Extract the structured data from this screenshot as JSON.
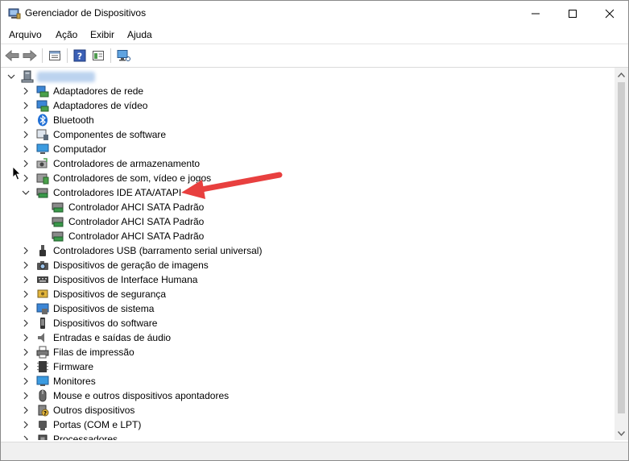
{
  "window": {
    "title": "Gerenciador de Dispositivos",
    "icon": "device-manager-icon"
  },
  "menu": {
    "items": [
      "Arquivo",
      "Ação",
      "Exibir",
      "Ajuda"
    ]
  },
  "toolbar": {
    "buttons": [
      "back-arrow-icon",
      "forward-arrow-icon",
      "properties-icon",
      "help-icon",
      "view-icon",
      "scan-hardware-icon"
    ]
  },
  "tree": {
    "root_label": "",
    "categories": [
      {
        "label": "Adaptadores de rede",
        "icon": "network-adapter-icon",
        "expanded": false
      },
      {
        "label": "Adaptadores de vídeo",
        "icon": "display-adapter-icon",
        "expanded": false
      },
      {
        "label": "Bluetooth",
        "icon": "bluetooth-icon",
        "expanded": false
      },
      {
        "label": "Componentes de software",
        "icon": "software-component-icon",
        "expanded": false
      },
      {
        "label": "Computador",
        "icon": "computer-icon",
        "expanded": false
      },
      {
        "label": "Controladores de armazenamento",
        "icon": "storage-controller-icon",
        "expanded": false
      },
      {
        "label": "Controladores de som, vídeo e jogos",
        "icon": "sound-icon",
        "expanded": false
      },
      {
        "label": "Controladores IDE ATA/ATAPI",
        "icon": "ide-controller-icon",
        "expanded": true,
        "children": [
          "Controlador AHCI SATA Padrão",
          "Controlador AHCI SATA Padrão",
          "Controlador AHCI SATA Padrão"
        ]
      },
      {
        "label": "Controladores USB (barramento serial universal)",
        "icon": "usb-icon",
        "expanded": false
      },
      {
        "label": "Dispositivos de geração de imagens",
        "icon": "camera-icon",
        "expanded": false
      },
      {
        "label": "Dispositivos de Interface Humana",
        "icon": "hid-icon",
        "expanded": false
      },
      {
        "label": "Dispositivos de segurança",
        "icon": "security-device-icon",
        "expanded": false
      },
      {
        "label": "Dispositivos de sistema",
        "icon": "system-device-icon",
        "expanded": false
      },
      {
        "label": "Dispositivos do software",
        "icon": "software-device-icon",
        "expanded": false
      },
      {
        "label": "Entradas e saídas de áudio",
        "icon": "audio-io-icon",
        "expanded": false
      },
      {
        "label": "Filas de impressão",
        "icon": "printer-icon",
        "expanded": false
      },
      {
        "label": "Firmware",
        "icon": "firmware-icon",
        "expanded": false
      },
      {
        "label": "Monitores",
        "icon": "monitor-icon",
        "expanded": false
      },
      {
        "label": "Mouse e outros dispositivos apontadores",
        "icon": "mouse-icon",
        "expanded": false
      },
      {
        "label": "Outros dispositivos",
        "icon": "other-device-icon",
        "expanded": false
      },
      {
        "label": "Portas (COM e LPT)",
        "icon": "port-icon",
        "expanded": false
      },
      {
        "label": "Processadores",
        "icon": "processor-icon",
        "expanded": false
      }
    ]
  },
  "colors": {
    "annotation_arrow": "#e8403f",
    "window_border": "#8a8a8a"
  }
}
